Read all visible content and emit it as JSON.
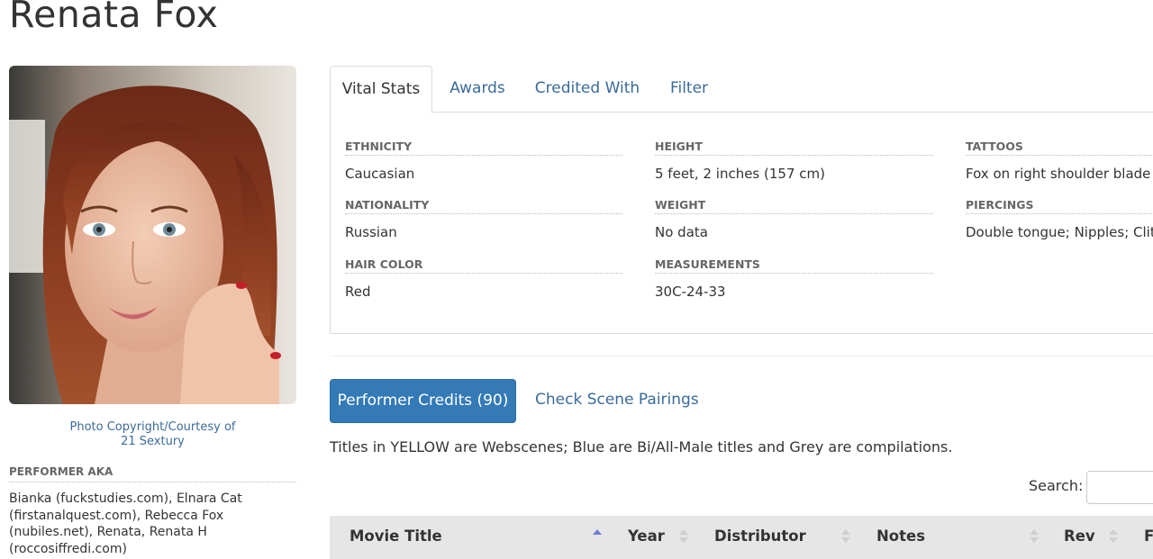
{
  "page": {
    "title": "Renata Fox"
  },
  "sidebar": {
    "photo_alt": "Renata Fox",
    "credit_line1": "Photo Copyright/Courtesy of",
    "credit_line2": "21 Sextury",
    "aka_label": "PERFORMER AKA",
    "aka_text": "Bianka (fuckstudies.com), Elnara Cat (firstanalquest.com), Rebecca Fox (nubiles.net), Renata, Renata H (roccosiffredi.com)"
  },
  "tabs": [
    {
      "label": "Vital Stats",
      "active": true
    },
    {
      "label": "Awards",
      "active": false
    },
    {
      "label": "Credited With",
      "active": false
    },
    {
      "label": "Filter",
      "active": false
    }
  ],
  "stats": {
    "ethnicity": {
      "label": "ETHNICITY",
      "value": "Caucasian"
    },
    "nationality": {
      "label": "NATIONALITY",
      "value": "Russian"
    },
    "hair_color": {
      "label": "HAIR COLOR",
      "value": "Red"
    },
    "height": {
      "label": "HEIGHT",
      "value": "5 feet, 2 inches (157 cm)"
    },
    "weight": {
      "label": "WEIGHT",
      "value": "No data"
    },
    "measurements": {
      "label": "MEASUREMENTS",
      "value": "30C-24-33"
    },
    "tattoos": {
      "label": "TATTOOS",
      "value": "Fox on right shoulder blade"
    },
    "piercings": {
      "label": "PIERCINGS",
      "value": "Double tongue; Nipples; Clit"
    }
  },
  "credits": {
    "button_label": "Performer Credits (90)",
    "pairings_label": "Check Scene Pairings",
    "legend_note": "Titles in YELLOW are Webscenes; Blue are Bi/All-Male titles and Grey are compilations."
  },
  "search": {
    "label": "Search:",
    "value": ""
  },
  "table": {
    "columns": [
      "Movie Title",
      "Year",
      "Distributor",
      "Notes",
      "Rev",
      "F"
    ],
    "sorted_column": "Movie Title",
    "sort_direction": "ascending"
  },
  "colors": {
    "link": "#3a6b9a",
    "primary_button": "#337ab7",
    "header_bg": "#e6e6e6"
  }
}
